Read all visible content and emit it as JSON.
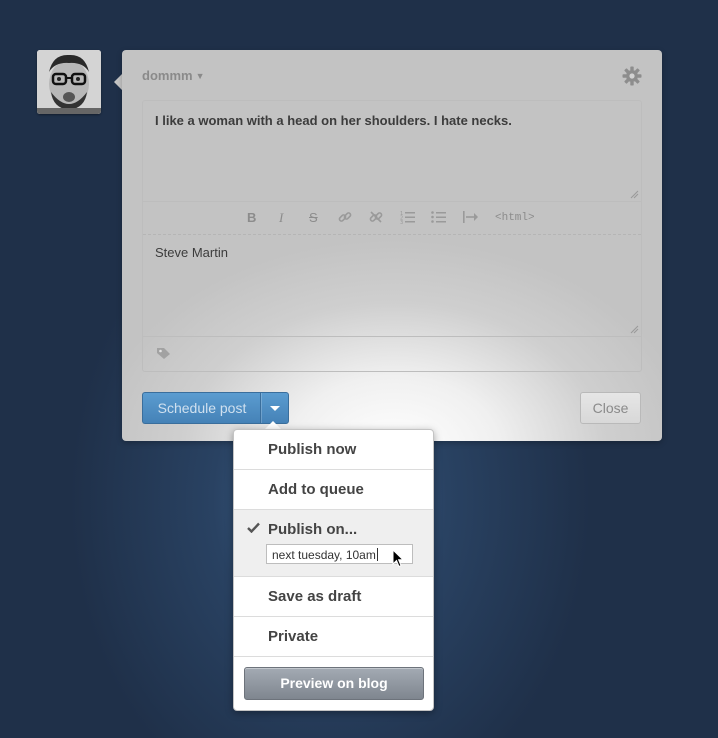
{
  "post_form": {
    "blog_name": "dommm",
    "title": "I like a woman with a head on her shoulders. I hate necks.",
    "body": "Steve Martin",
    "toolbar": {
      "bold": "B",
      "italic": "I",
      "strike": "S",
      "html": "<html>"
    }
  },
  "actions": {
    "schedule_label": "Schedule post",
    "close_label": "Close"
  },
  "menu": {
    "publish_now": "Publish now",
    "add_to_queue": "Add to queue",
    "publish_on": "Publish on...",
    "publish_on_value": "next tuesday, 10am",
    "save_as_draft": "Save as draft",
    "private": "Private",
    "preview": "Preview on blog"
  },
  "colors": {
    "background": "#1f3049",
    "primary_button": "#4f8fc4",
    "preview_button": "#8a9199"
  },
  "icons": [
    "gear-icon",
    "tag-icon",
    "checkmark-icon",
    "chevron-down-icon"
  ]
}
